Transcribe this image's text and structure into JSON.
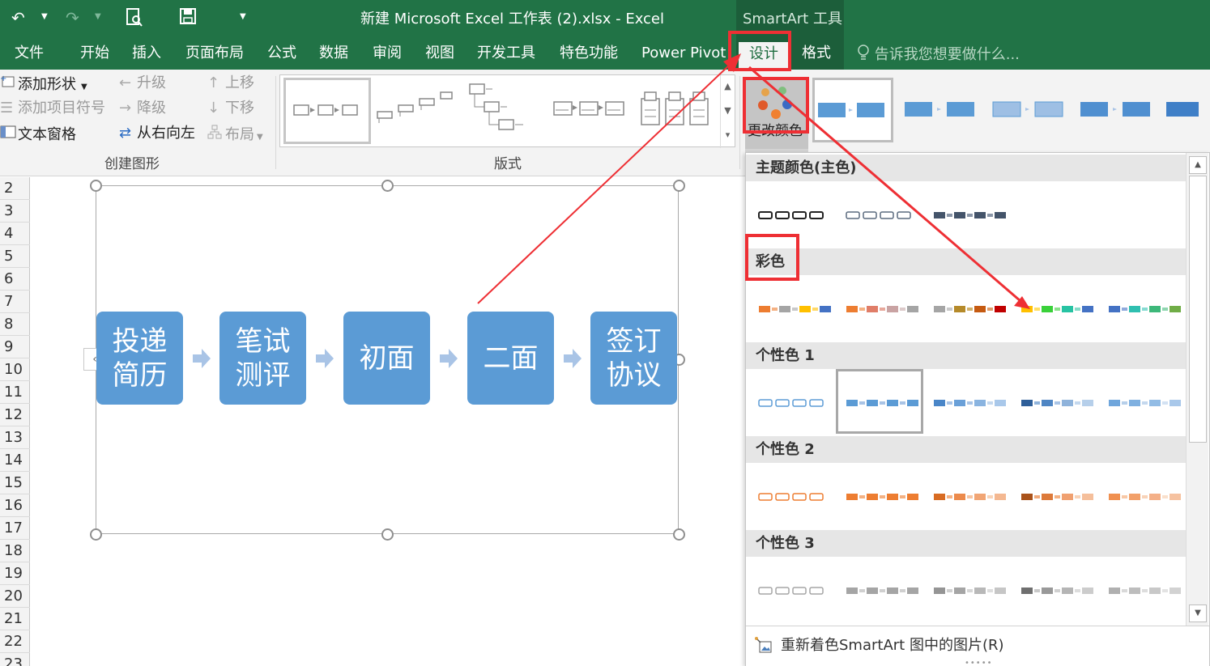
{
  "app": {
    "window_title": "新建 Microsoft Excel 工作表 (2).xlsx - Excel",
    "context_tab_group": "SmartArt 工具"
  },
  "quick_access": {
    "undo": "↶",
    "redo": "↷",
    "print_preview": "🔍",
    "save": "💾",
    "customize": "▾"
  },
  "tabs": [
    "文件",
    "开始",
    "插入",
    "页面布局",
    "公式",
    "数据",
    "审阅",
    "视图",
    "开发工具",
    "特色功能",
    "Power Pivot",
    "设计",
    "格式"
  ],
  "active_tab": "设计",
  "tell_me": "告诉我您想要做什么...",
  "ribbon": {
    "create_graphic": {
      "label": "创建图形",
      "add_shape": "添加形状",
      "add_bullet": "添加项目符号",
      "text_pane": "文本窗格",
      "promote": "升级",
      "demote": "降级",
      "right_to_left": "从右向左",
      "move_up": "上移",
      "move_down": "下移",
      "layout": "布局"
    },
    "layouts": {
      "label": "版式"
    },
    "change_colors": "更改颜色"
  },
  "sheet": {
    "rows": [
      "2",
      "3",
      "4",
      "5",
      "6",
      "7",
      "8",
      "9",
      "10",
      "11",
      "12",
      "13",
      "14",
      "15",
      "16",
      "17",
      "18",
      "19",
      "20",
      "21",
      "22",
      "23"
    ]
  },
  "smartart": {
    "steps": [
      "投递简历",
      "笔试测评",
      "初面",
      "二面",
      "签订协议"
    ],
    "box_color": "#5B9BD5",
    "arrow_color": "#A9C4E6"
  },
  "color_menu": {
    "sections": [
      "主题颜色(主色)",
      "彩色",
      "个性色 1",
      "个性色 2",
      "个性色 3"
    ],
    "recolor_pictures": "重新着色SmartArt 图中的图片(R)"
  },
  "annotation_color": "#EE2F34"
}
